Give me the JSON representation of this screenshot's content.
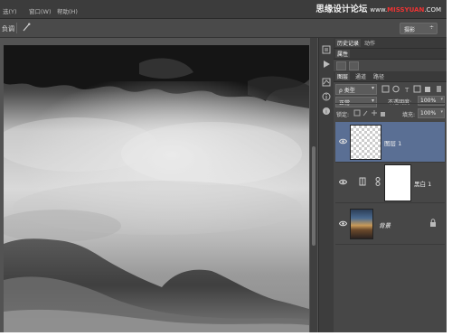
{
  "menubar": {
    "items": [
      "选(Y)",
      "窗口(W)",
      "帮助(H)"
    ],
    "watermark_cn": "思缘设计论坛",
    "watermark_url": "www.MISSYUAN.COM",
    "watermark_url_accent": "MISSYUAN"
  },
  "options": {
    "tool_label": "负调",
    "workspace": "摄影",
    "workspace_arrow": "÷"
  },
  "panels": {
    "top_tabs": [
      "历史记录",
      "动作"
    ],
    "second_tabs": [
      "属性"
    ],
    "layers_tabs": [
      "图层",
      "通道",
      "路径"
    ],
    "kind_filter": "ρ 类型",
    "blend_mode": "正常",
    "opacity_label": "不透明度:",
    "opacity_value": "100%",
    "lock_label": "锁定:",
    "fill_label": "填充:",
    "fill_value": "100%"
  },
  "layers": [
    {
      "name": "图层 1",
      "selected": true,
      "visible": true
    },
    {
      "name": "黑白 1",
      "selected": false,
      "visible": true,
      "type": "adjustment"
    },
    {
      "name": "背景",
      "selected": false,
      "visible": true,
      "locked": true
    }
  ],
  "colors": {
    "selection": "#5a6f94",
    "panel": "#474747",
    "watermark_accent": "#ee3333"
  }
}
